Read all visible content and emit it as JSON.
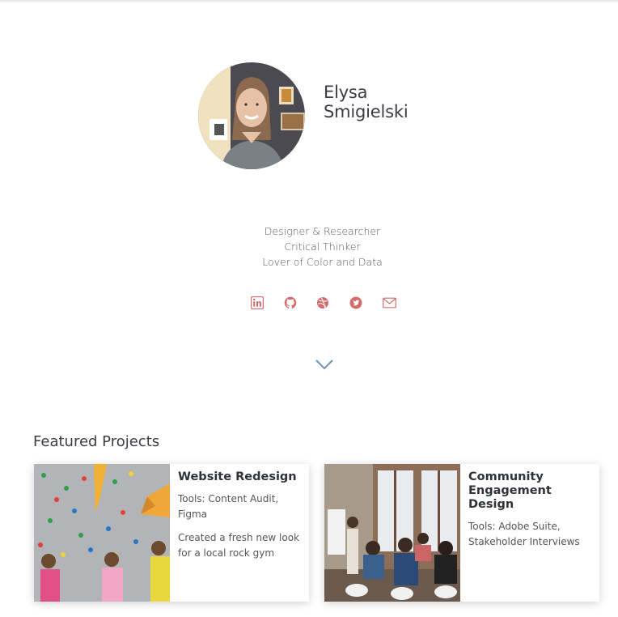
{
  "profile": {
    "first_name": "Elysa",
    "last_name": "Smigielski",
    "taglines": [
      "Designer & Researcher",
      "Critical Thinker",
      "Lover of Color and Data"
    ]
  },
  "socials": [
    {
      "icon": "linkedin-icon"
    },
    {
      "icon": "github-icon"
    },
    {
      "icon": "dribbble-icon"
    },
    {
      "icon": "twitter-icon"
    },
    {
      "icon": "email-icon"
    }
  ],
  "colors": {
    "accent": "#d46a6a",
    "chevron": "#6a94b8",
    "heading": "#3a3d45"
  },
  "featured": {
    "title": "Featured Projects",
    "projects": [
      {
        "title": "Website Redesign",
        "tools": "Tools: Content Audit, Figma",
        "description": "Created a fresh new look for a local rock gym"
      },
      {
        "title": "Community Engagement Design",
        "tools": "Tools: Adobe Suite, Stakeholder Interviews",
        "description": ""
      }
    ]
  }
}
